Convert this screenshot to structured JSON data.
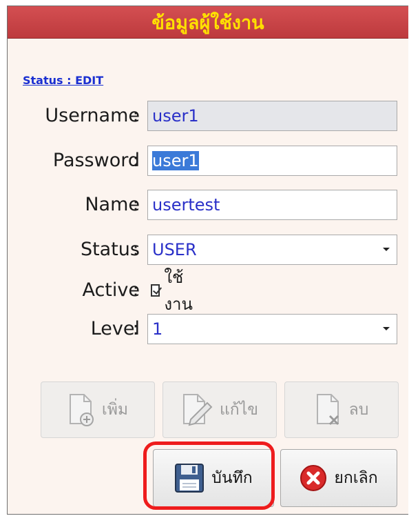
{
  "window": {
    "title": "ข้อมูลผู้ใช้งาน"
  },
  "status_link": "Status : EDIT",
  "form": {
    "username": {
      "label": "Username",
      "colon": ":",
      "value": "user1"
    },
    "password": {
      "label": "Password",
      "colon": ":",
      "value": "user1"
    },
    "name": {
      "label": "Name",
      "colon": ":",
      "value": "usertest"
    },
    "status": {
      "label": "Status",
      "colon": ":",
      "value": "USER"
    },
    "active": {
      "label": "Active",
      "colon": ":",
      "checkbox_label": "ใช้งาน",
      "checked": true
    },
    "level": {
      "label": "Level",
      "colon": ":",
      "value": "1"
    }
  },
  "buttons": {
    "add": "เพิ่ม",
    "edit": "แก้ไข",
    "delete": "ลบ",
    "save": "บันทึก",
    "cancel": "ยกเลิก"
  },
  "colors": {
    "title_bg": "#c94447",
    "title_text": "#ffe100",
    "value_text": "#2a30c8",
    "highlight": "#ee1c1c"
  }
}
